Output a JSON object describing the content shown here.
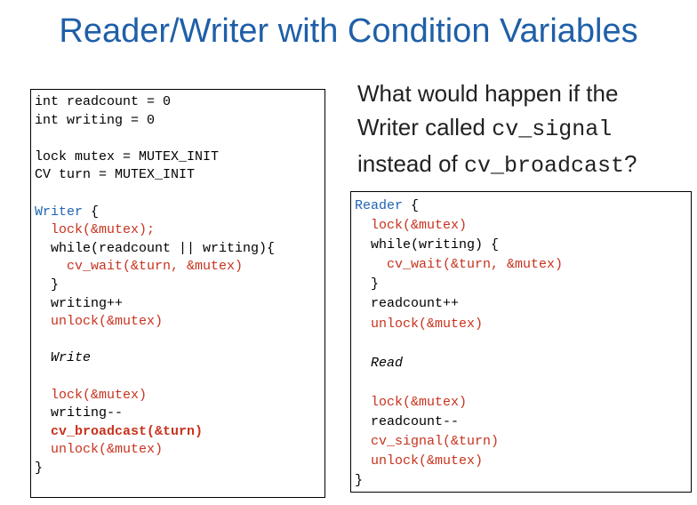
{
  "title": "Reader/Writer with Condition Variables",
  "question": {
    "part1": "What would happen if the",
    "part2": "Writer called",
    "code1": "cv_signal",
    "part3": "instead of",
    "code2": "cv_broadcast",
    "part4": "?"
  },
  "writer_code": [
    {
      "text": "int readcount = 0",
      "style": ""
    },
    {
      "text": "int writing = 0",
      "style": ""
    },
    {
      "text": "",
      "style": ""
    },
    {
      "text": "lock mutex = MUTEX_INIT",
      "style": ""
    },
    {
      "text": "CV turn = MUTEX_INIT",
      "style": ""
    },
    {
      "text": "",
      "style": ""
    },
    {
      "text": "Writer",
      "suffix": " {",
      "style": "kw"
    },
    {
      "text": "  lock(&mutex);",
      "style": "red"
    },
    {
      "text": "  while(readcount || writing){",
      "style": ""
    },
    {
      "text": "    cv_wait(&turn, &mutex)",
      "style": "red"
    },
    {
      "text": "  }",
      "style": ""
    },
    {
      "text": "  writing++",
      "style": ""
    },
    {
      "text": "  unlock(&mutex)",
      "style": "red"
    },
    {
      "text": "",
      "style": ""
    },
    {
      "text": "  Write",
      "style": "it"
    },
    {
      "text": "",
      "style": ""
    },
    {
      "text": "  lock(&mutex)",
      "style": "red"
    },
    {
      "text": "  writing--",
      "style": ""
    },
    {
      "text": "  cv_broadcast(&turn)",
      "style": "red bold"
    },
    {
      "text": "  unlock(&mutex)",
      "style": "red"
    },
    {
      "text": "}",
      "style": ""
    }
  ],
  "reader_code": [
    {
      "text": "Reader",
      "suffix": " {",
      "style": "kw"
    },
    {
      "text": "  lock(&mutex)",
      "style": "red"
    },
    {
      "text": "  while(writing) {",
      "style": ""
    },
    {
      "text": "    cv_wait(&turn, &mutex)",
      "style": "red"
    },
    {
      "text": "  }",
      "style": ""
    },
    {
      "text": "  readcount++",
      "style": ""
    },
    {
      "text": "  unlock(&mutex)",
      "style": "red"
    },
    {
      "text": "",
      "style": ""
    },
    {
      "text": "  Read",
      "style": "it"
    },
    {
      "text": "",
      "style": ""
    },
    {
      "text": "  lock(&mutex)",
      "style": "red"
    },
    {
      "text": "  readcount--",
      "style": ""
    },
    {
      "text": "  cv_signal(&turn)",
      "style": "red"
    },
    {
      "text": "  unlock(&mutex)",
      "style": "red"
    },
    {
      "text": "}",
      "style": ""
    }
  ]
}
